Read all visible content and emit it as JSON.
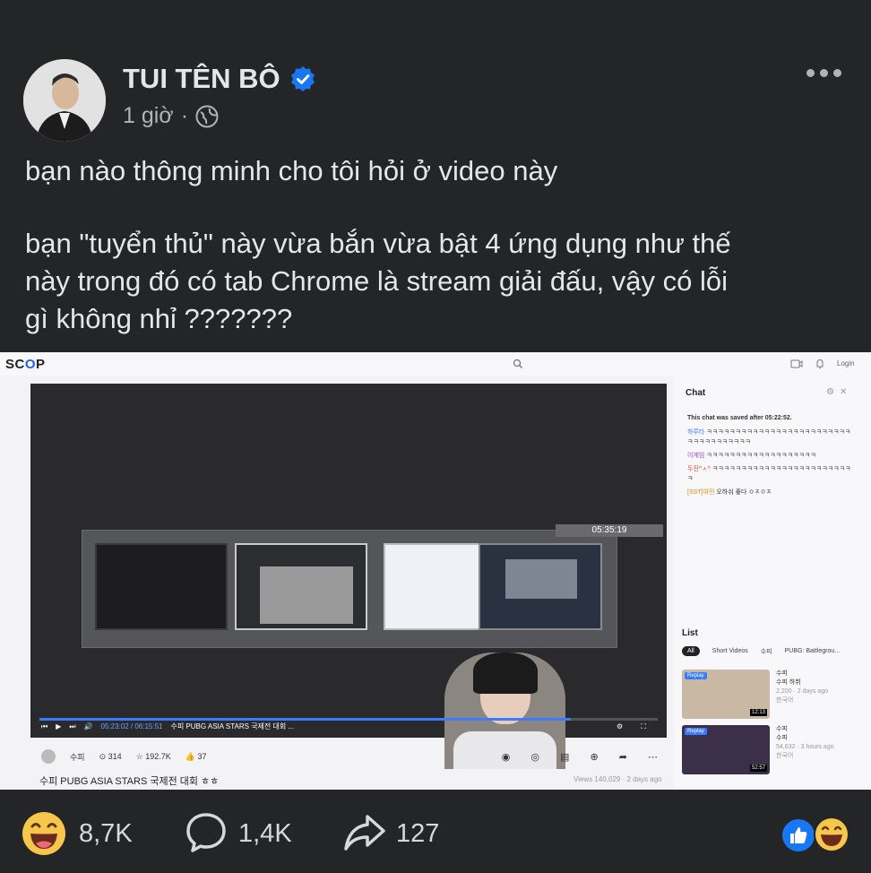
{
  "post": {
    "author": "TUI TÊN BÔ",
    "time": "1 giờ",
    "dot": "·",
    "line1": "bạn nào thông minh cho tôi hỏi ở video này",
    "line2": "bạn \"tuyển thủ\" này vừa bắn vừa bật 4 ứng dụng như thế",
    "line3": "này trong đó có tab Chrome là stream giải đấu, vậy có lỗi",
    "line4": "gì không nhỉ ???????"
  },
  "screenshot": {
    "logo_sc": "SC",
    "logo_oo": "O",
    "logo_p": "P",
    "login": "Login",
    "switcher_time": "05:35:19",
    "player_time": "05:23:02 / 06:15:51",
    "player_title": "수피 PUBG ASIA STARS  국제전 대회 ...",
    "progress_fraction": 0.86,
    "streamer": "수피",
    "stat_viewers": "314",
    "stat_likes": "192.7K",
    "stat_thumbs": "37",
    "video_title": "수피 PUBG ASIA STARS 국제전 대회 ㅎㅎ",
    "views": "Views 140,029",
    "ago": "2 days ago",
    "chat_title": "Chat",
    "chat_saved": "This chat was saved after 05:22:52.",
    "chat": [
      {
        "user": "하루타",
        "msg": "ㅋㅋㅋㅋㅋㅋㅋㅋㅋㅋㅋㅋㅋㅋㅋㅋㅋㅋㅋㅋㅋㅋㅋㅋㅋㅋㅋㅋㅋㅋㅋㅋㅋㅋㅋㅋ"
      },
      {
        "user": "이게임",
        "msg": "ㅋㅋㅋㅋㅋㅋㅋㅋㅋㅋㅋㅋㅋㅋㅋㅋㅋㅋㅋ"
      },
      {
        "user": "두진^ㅅ^",
        "msg": "ㅋㅋㅋㅋㅋㅋㅋㅋㅋㅋㅋㅋㅋㅋㅋㅋㅋㅋㅋㅋㅋㅋㅋㅋㅋ"
      },
      {
        "user": "[SST]여민",
        "msg": "오하쉬 좋다 ㅇㅈㅇㅈ"
      }
    ],
    "list_title": "List",
    "tabs": [
      "All",
      "Short Videos",
      "수피",
      "PUBG: Battlegrou..."
    ],
    "cards": [
      {
        "badge": "Replay",
        "duration": "12:13",
        "name": "수피",
        "title": "수피 하뷔",
        "meta": "2,200 · 2 days ago",
        "tag": "한국어"
      },
      {
        "badge": "Replay",
        "duration": "52:57",
        "name": "수피",
        "title": "수피",
        "meta": "54,632 · 3 hours ago",
        "tag": "한국어"
      }
    ]
  },
  "reactions": {
    "likes": "8,7K",
    "comments": "1,4K",
    "shares": "127"
  },
  "icons": [
    "verified-icon",
    "globe-icon",
    "more-icon",
    "search-icon",
    "bell-icon",
    "comment-icon",
    "share-icon",
    "like-icon",
    "haha-icon"
  ],
  "colors": {
    "bg": "#242526",
    "text": "#e4e6eb",
    "muted": "#b0b3b8",
    "verified": "#1877f2",
    "accent": "#3a7bff"
  }
}
